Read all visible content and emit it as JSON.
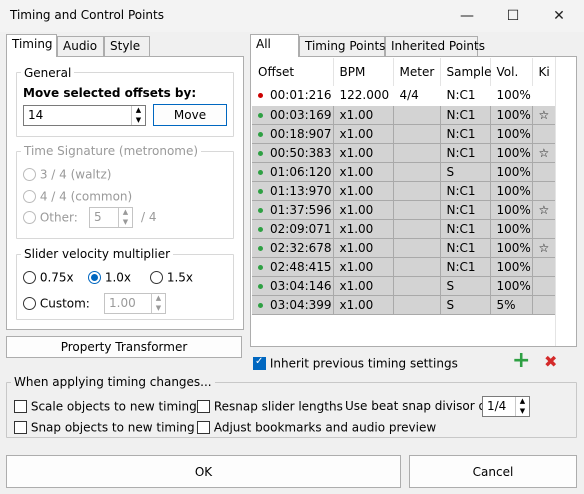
{
  "window": {
    "title": "Timing and Control Points",
    "minimize": "—",
    "maximize": "☐",
    "close": "✕"
  },
  "left_tabs": [
    "Timing",
    "Audio",
    "Style"
  ],
  "general": {
    "title": "General",
    "move_label": "Move selected offsets by:",
    "offset_value": "14",
    "move_button": "Move"
  },
  "time_signature": {
    "title": "Time Signature (metronome)",
    "option1": "3 / 4 (waltz)",
    "option2": "4 / 4 (common)",
    "option3": "Other:",
    "other_value": "5",
    "other_suffix": "/ 4"
  },
  "slider_velocity": {
    "title": "Slider velocity multiplier",
    "opt1": "0.75x",
    "opt2": "1.0x",
    "opt3": "1.5x",
    "custom_label": "Custom:",
    "custom_value": "1.00",
    "selected": "1.0x"
  },
  "property_transformer": "Property Transformer",
  "right_tabs": [
    "All",
    "Timing Points",
    "Inherited Points"
  ],
  "table": {
    "headers": [
      "Offset",
      "BPM",
      "Meter",
      "Sample",
      "Vol.",
      "Ki"
    ],
    "rows": [
      {
        "kind": "red",
        "offset": "00:01:216",
        "bpm": "122.000",
        "meter": "4/4",
        "sample": "N:C1",
        "vol": "100%",
        "kiai": ""
      },
      {
        "kind": "green",
        "offset": "00:03:169",
        "bpm": "x1.00",
        "meter": "",
        "sample": "N:C1",
        "vol": "100%",
        "kiai": "☆"
      },
      {
        "kind": "green",
        "offset": "00:18:907",
        "bpm": "x1.00",
        "meter": "",
        "sample": "N:C1",
        "vol": "100%",
        "kiai": ""
      },
      {
        "kind": "green",
        "offset": "00:50:383",
        "bpm": "x1.00",
        "meter": "",
        "sample": "N:C1",
        "vol": "100%",
        "kiai": "☆"
      },
      {
        "kind": "green",
        "offset": "01:06:120",
        "bpm": "x1.00",
        "meter": "",
        "sample": "S",
        "vol": "100%",
        "kiai": ""
      },
      {
        "kind": "green",
        "offset": "01:13:970",
        "bpm": "x1.00",
        "meter": "",
        "sample": "N:C1",
        "vol": "100%",
        "kiai": ""
      },
      {
        "kind": "green",
        "offset": "01:37:596",
        "bpm": "x1.00",
        "meter": "",
        "sample": "N:C1",
        "vol": "100%",
        "kiai": "☆"
      },
      {
        "kind": "green",
        "offset": "02:09:071",
        "bpm": "x1.00",
        "meter": "",
        "sample": "N:C1",
        "vol": "100%",
        "kiai": ""
      },
      {
        "kind": "green",
        "offset": "02:32:678",
        "bpm": "x1.00",
        "meter": "",
        "sample": "N:C1",
        "vol": "100%",
        "kiai": "☆"
      },
      {
        "kind": "green",
        "offset": "02:48:415",
        "bpm": "x1.00",
        "meter": "",
        "sample": "N:C1",
        "vol": "100%",
        "kiai": ""
      },
      {
        "kind": "green",
        "offset": "03:04:146",
        "bpm": "x1.00",
        "meter": "",
        "sample": "S",
        "vol": "100%",
        "kiai": ""
      },
      {
        "kind": "green",
        "offset": "03:04:399",
        "bpm": "x1.00",
        "meter": "",
        "sample": "S",
        "vol": "5%",
        "kiai": ""
      }
    ]
  },
  "inherit_label": "Inherit previous timing settings",
  "inherit_checked": true,
  "add_icon": "+",
  "delete_icon": "✖",
  "colors": {
    "red_point": "#cc0000",
    "green_point": "#2ea043",
    "accent": "#0067c0",
    "inherited_row": "#d3d3d3"
  },
  "applying": {
    "title": "When applying timing changes...",
    "scale": "Scale objects to new timing",
    "resnap": "Resnap slider lengths",
    "beat_snap_label": "Use beat snap divisor of",
    "beat_snap_value": "1/4",
    "snap": "Snap objects to new timing",
    "bookmarks": "Adjust bookmarks and audio preview"
  },
  "ok": "OK",
  "cancel": "Cancel"
}
